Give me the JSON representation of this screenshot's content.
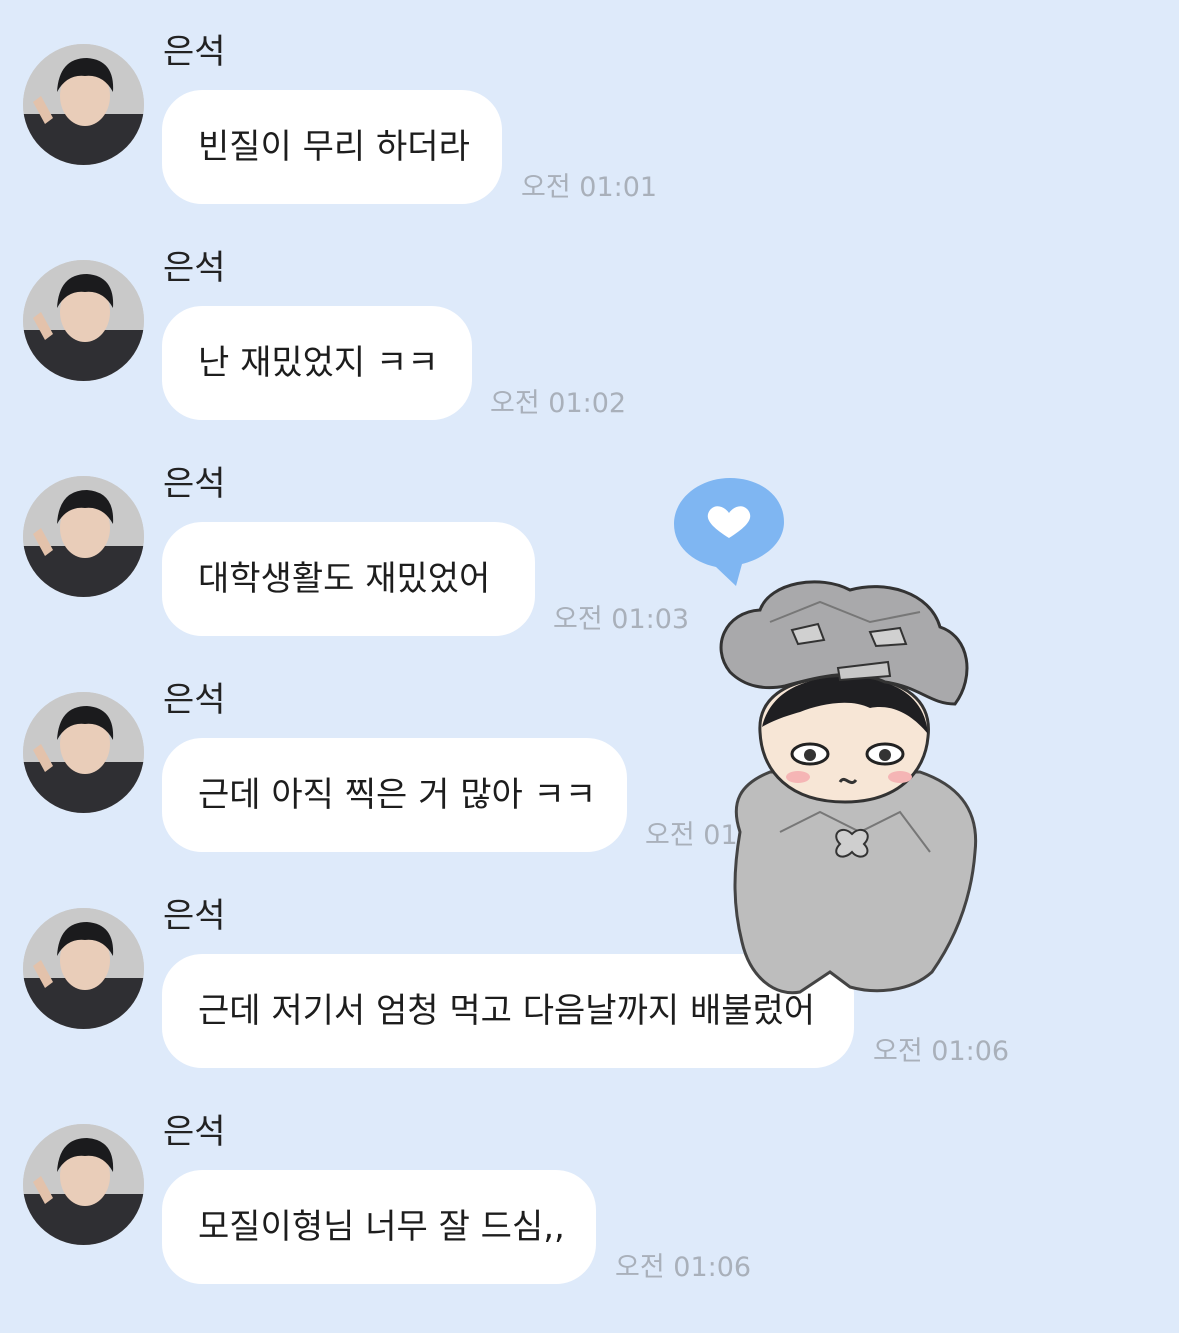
{
  "messages": [
    {
      "sender": "은석",
      "text": "빈질이 무리 하더라",
      "time": "오전 01:01"
    },
    {
      "sender": "은석",
      "text": "난 재밌었지 ㅋㅋ",
      "time": "오전 01:02"
    },
    {
      "sender": "은석",
      "text": "대학생활도 재밌었어",
      "time": "오전 01:03"
    },
    {
      "sender": "은석",
      "text": "근데 아직 찍은 거 많아 ㅋㅋ",
      "time": "오전 01:05"
    },
    {
      "sender": "은석",
      "text": "근데 저기서 엄청 먹고 다음날까지 배불렀어",
      "time": "오전 01:06"
    },
    {
      "sender": "은석",
      "text": "모질이형님 너무 잘 드심,,",
      "time": "오전 01:06"
    }
  ],
  "colors": {
    "background": "#deeafa",
    "bubble": "#ffffff",
    "timestamp": "#a9b0ba",
    "heart_bubble": "#7fb6f2"
  },
  "icons": {
    "avatar": "profile-photo",
    "sticker": "rock-hat-character-sticker",
    "heart": "heart-speech-bubble-icon"
  }
}
